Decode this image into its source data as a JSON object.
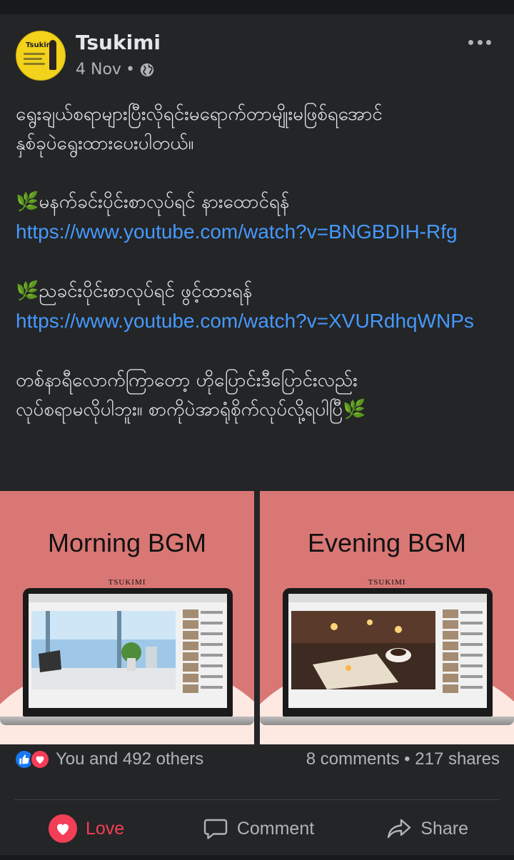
{
  "post": {
    "author": "Tsukimi",
    "date": "4 Nov",
    "separator": "•",
    "privacy_icon": "globe-icon",
    "more_icon": "more-horizontal-icon",
    "avatar_label": "Tsukimi"
  },
  "content": {
    "line1": "ရွေးချယ်စရာများပြီးလိုရင်းမရောက်တာမျိုးမဖြစ်ရအောင်",
    "line2": "နှစ်ခုပဲရွေးထားပေးပါတယ်။",
    "section1_leaf": "🌿",
    "section1_label": "မနက်ခင်းပိုင်းစာလုပ်ရင် နားထောင်ရန်",
    "section1_link": "https://www.youtube.com/watch?v=BNGBDIH-Rfg",
    "section2_leaf": "🌿",
    "section2_label": "ညခင်းပိုင်းစာလုပ်ရင် ဖွင့်ထားရန်",
    "section2_link": "https://www.youtube.com/watch?v=XVURdhqWNPs",
    "closing1": "တစ်နာရီလောက်ကြာတော့ ဟိုပြောင်းဒီပြောင်းလည်း",
    "closing2": "လုပ်စရာမလိုပါဘူး။ စာကိုပဲအာရုံစိုက်လုပ်လို့ရပါပြီ",
    "closing_leaf": "🌿"
  },
  "images": [
    {
      "heading": "Morning BGM",
      "brand": "TSUKIMI"
    },
    {
      "heading": "Evening BGM",
      "brand": "TSUKIMI"
    }
  ],
  "stats": {
    "reactions_text": "You and 492 others",
    "comments": "8 comments",
    "dot": "•",
    "shares": "217 shares"
  },
  "actions": {
    "love": "Love",
    "comment": "Comment",
    "share": "Share"
  },
  "colors": {
    "background": "#242526",
    "link": "#4599ff",
    "love": "#f33e58",
    "like": "#1877f2",
    "image_bg": "#d97775"
  }
}
